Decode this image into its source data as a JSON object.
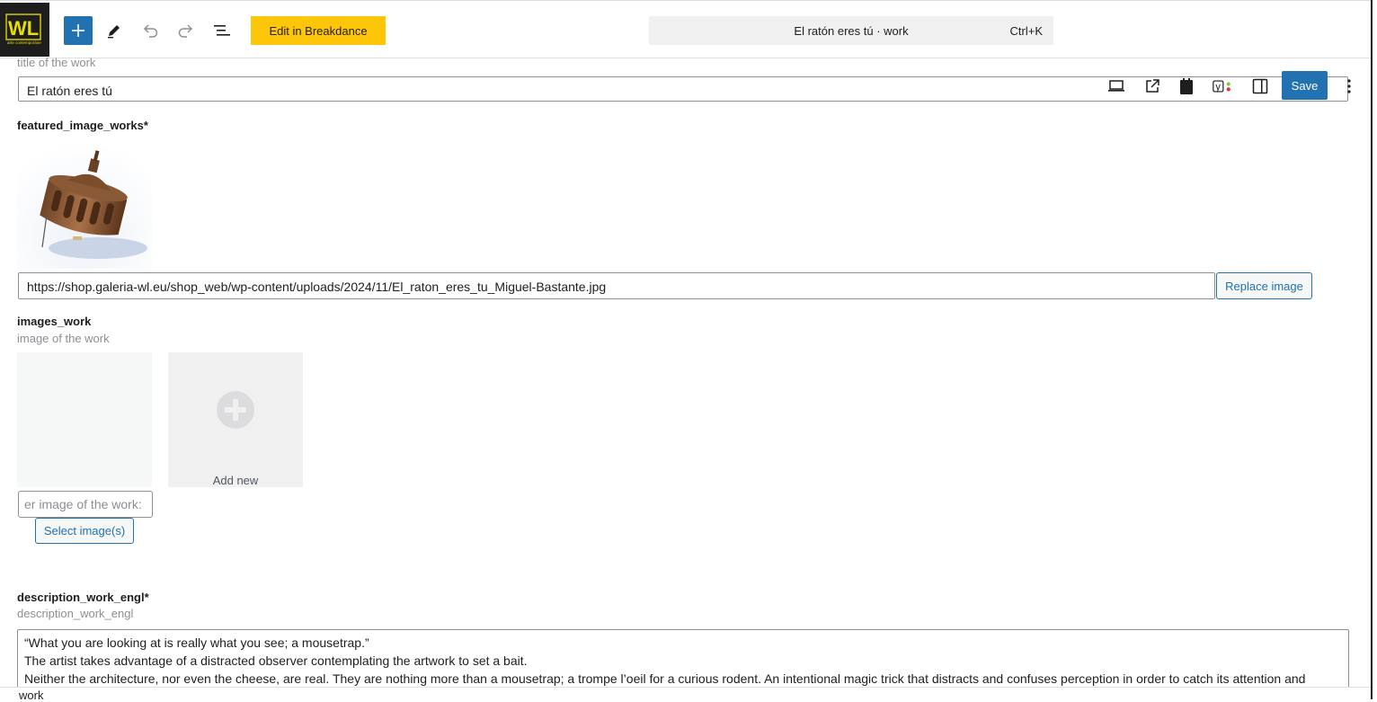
{
  "toolbar": {
    "logo_text": "WL",
    "logo_subtext": "arte contemporáneo",
    "breakdance_label": "Edit in Breakdance",
    "command_title": "El ratón eres tú · work",
    "command_shortcut": "Ctrl+K",
    "save_label": "Save"
  },
  "fields": {
    "title_desc": "title of the work",
    "title_value": "El ratón eres tú",
    "featured_label": "featured_image_works*",
    "featured_url": "https://shop.galeria-wl.eu/shop_web/wp-content/uploads/2024/11/El_raton_eres_tu_Miguel-Bastante.jpg",
    "replace_label": "Replace image",
    "images_label": "images_work",
    "images_desc": "image of the work",
    "add_new_label": "Add new",
    "alt_placeholder": "Enter image of the work",
    "alt_visible": ":er image of the work",
    "select_label": "Select image(s)",
    "description_label": "description_work_engl*",
    "description_desc": "description_work_engl",
    "description_lines": [
      "“What you are looking at is really what you see; a mousetrap.”",
      "The artist takes advantage of a distracted observer contemplating the artwork to set a bait.",
      "Neither the architecture, nor even the cheese, are real. They are nothing more than a mousetrap; a trompe l’oeil for a curious rodent. An intentional magic trick that distracts and confuses perception in order to catch its attention and"
    ]
  },
  "status": {
    "breadcrumb": "work"
  },
  "colors": {
    "accent": "#2271b1",
    "breakdance": "#fec609",
    "dark": "#1e1e1e"
  }
}
